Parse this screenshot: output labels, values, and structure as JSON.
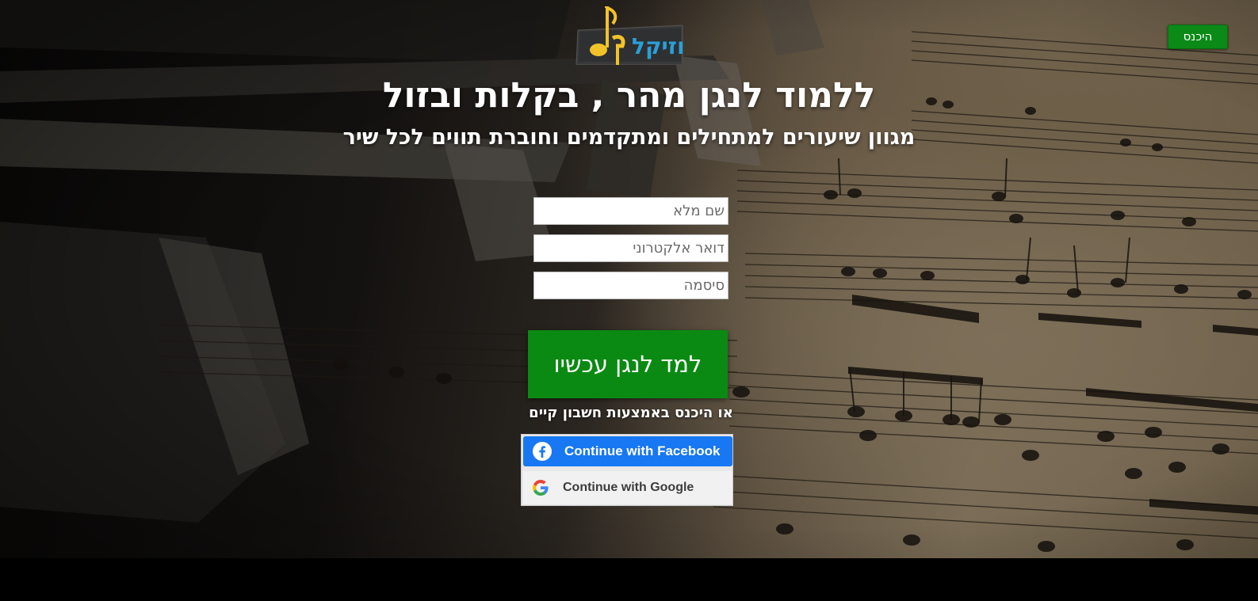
{
  "header": {
    "logo_text": "מוזיקל",
    "login_label": "היכנס"
  },
  "hero": {
    "headline": "ללמוד לנגן מהר , בקלות ובזול",
    "subheadline": "מגוון שיעורים למתחילים ומתקדמים וחוברת תווים לכל שיר"
  },
  "signup": {
    "fullname_placeholder": "שם מלא",
    "email_placeholder": "דואר אלקטרוני",
    "password_placeholder": "סיסמה",
    "submit_label": "למד לנגן עכשיו",
    "or_text": "או היכנס באמצעות חשבון קיים"
  },
  "social": {
    "facebook_label": "Continue with Facebook",
    "google_label": "Continue with Google"
  },
  "icons": {
    "facebook": "facebook-icon",
    "google": "google-icon",
    "logo_note": "music-note-icon"
  },
  "colors": {
    "cta_green": "#0a8a12",
    "facebook_blue": "#1877f2",
    "logo_blue": "#2a9fd8",
    "logo_yellow": "#f2c22a"
  }
}
